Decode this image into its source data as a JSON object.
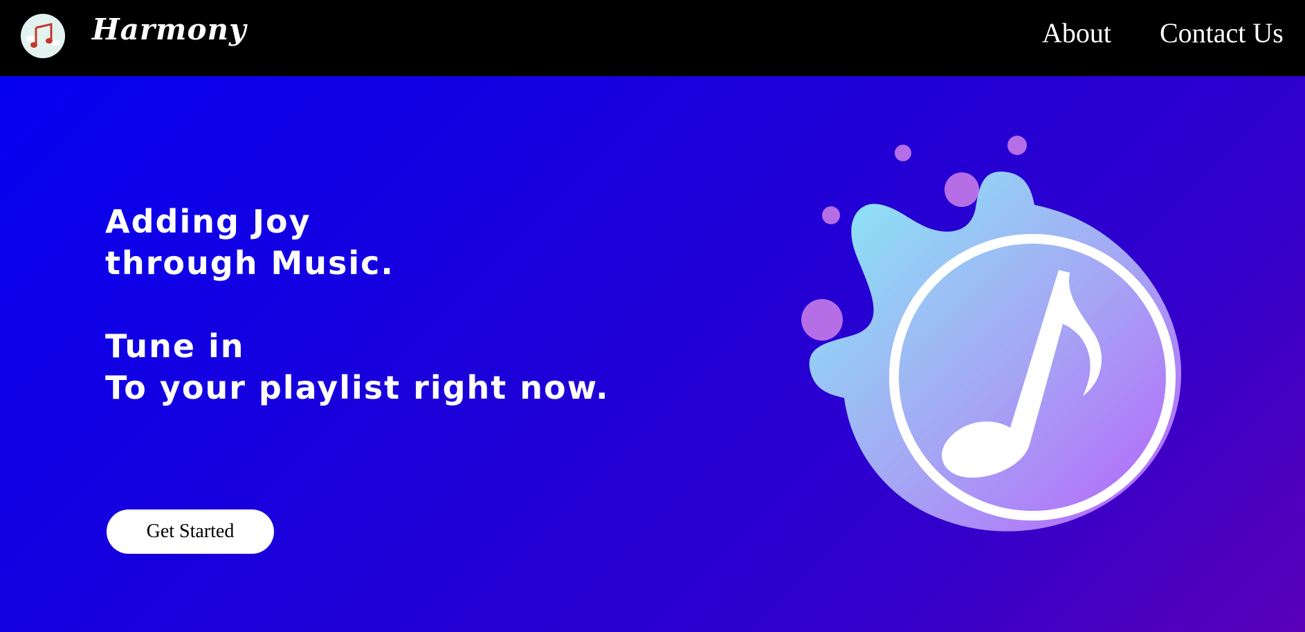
{
  "navbar": {
    "brand": "Harmony",
    "logo_icon": "music-note-icon",
    "links": [
      {
        "label": "About"
      },
      {
        "label": "Contact Us"
      }
    ]
  },
  "hero": {
    "headline_lines": [
      "Adding Joy",
      "through Music.",
      "Tune in",
      "To your playlist right now."
    ],
    "cta_label": "Get Started",
    "illustration_icon": "music-note-icon"
  },
  "colors": {
    "navbar_bg": "#000000",
    "hero_gradient_start": "#0500f0",
    "hero_gradient_end": "#5a00b8",
    "accent_cyan": "#88e6f5",
    "accent_purple": "#b76bf8",
    "bubble": "#b56ee6"
  }
}
